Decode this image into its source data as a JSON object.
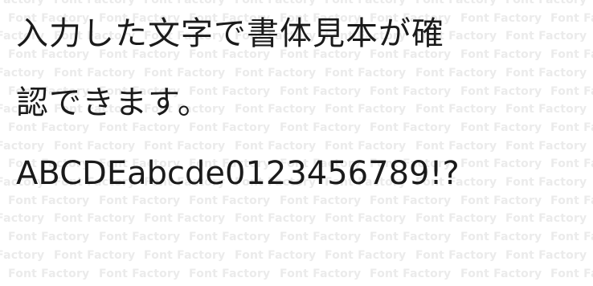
{
  "sample": {
    "line1": "入力した文字で書体見本が確",
    "line2": "認できます。",
    "line3": "ABCDEabcde0123456789!?"
  },
  "watermark": {
    "text": "Font Factory",
    "color": "#ebebeb"
  },
  "colors": {
    "background": "#ffffff",
    "text": "#1a1a1a"
  }
}
